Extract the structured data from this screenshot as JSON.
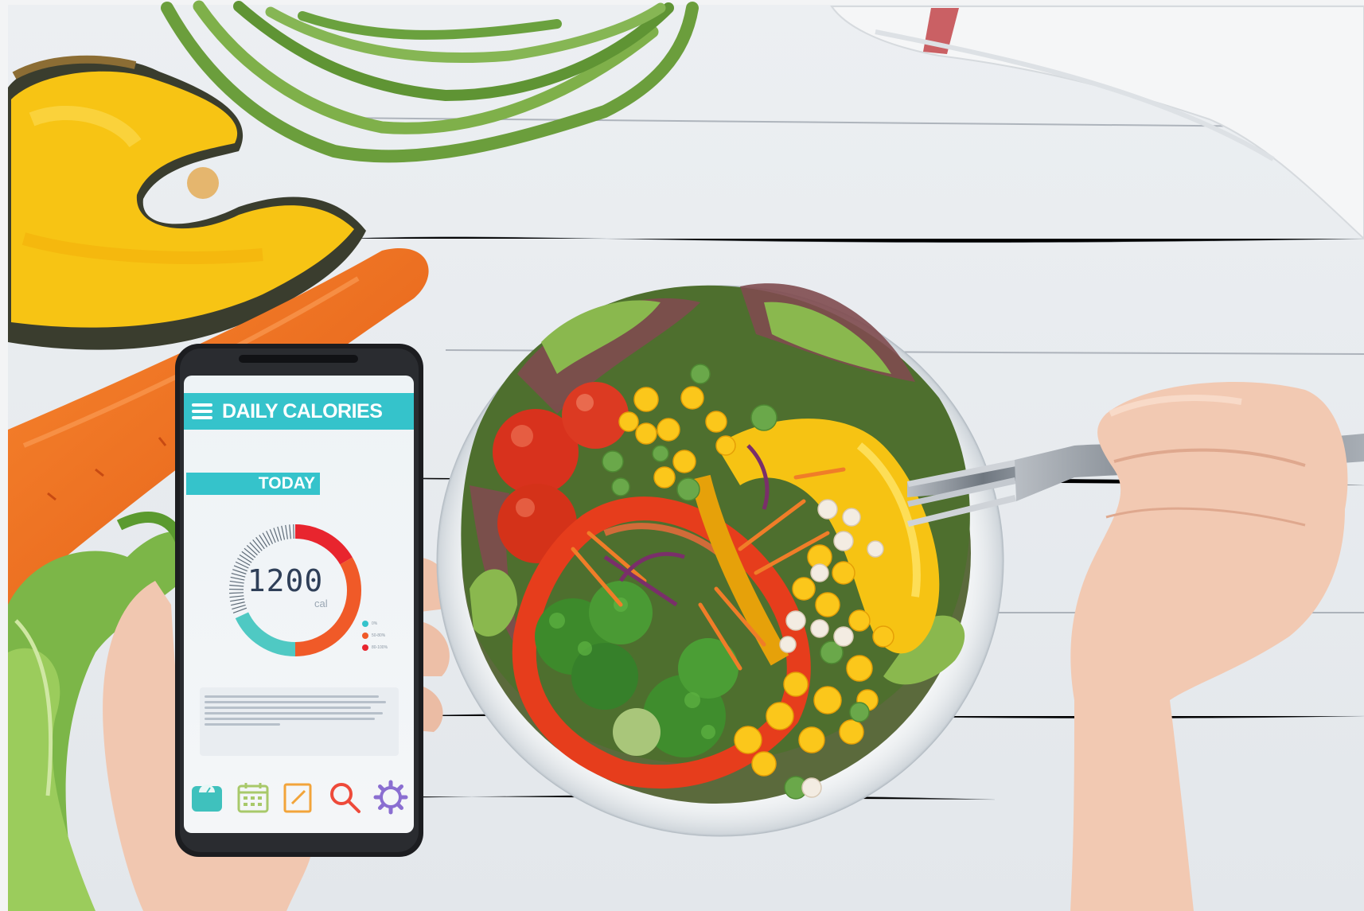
{
  "phone_app": {
    "title": "DAILY CALORIES",
    "tab": "TODAY",
    "calories_value": "1200",
    "calories_unit": "cal",
    "gauge_fraction_filled": 0.6,
    "legend": [
      {
        "color": "#35c3cb",
        "label": "0%"
      },
      {
        "color": "#f05a28",
        "label": "50-80%"
      },
      {
        "color": "#e8252e",
        "label": "80-100%"
      }
    ],
    "nav_icons": [
      "scale-icon",
      "calendar-icon",
      "notes-icon",
      "search-icon",
      "settings-icon"
    ],
    "colors": {
      "accent": "#35c3cb",
      "gauge_red": "#e8252e",
      "gauge_orange": "#f05a28",
      "gauge_teal": "#4fc9c3"
    }
  }
}
